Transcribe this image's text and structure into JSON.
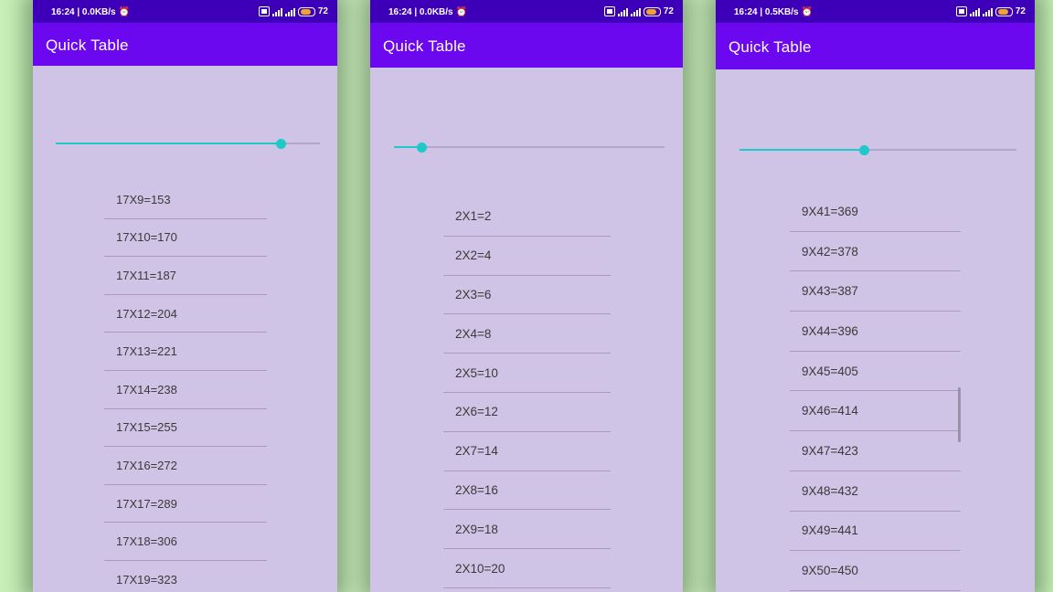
{
  "screens": [
    {
      "status": {
        "time": "16:24 | 0.0KB/s",
        "battery": "72"
      },
      "app_title": "Quick Table",
      "slider_value_fraction": 0.85,
      "rows": [
        "17X9=153",
        "17X10=170",
        "17X11=187",
        "17X12=204",
        "17X13=221",
        "17X14=238",
        "17X15=255",
        "17X16=272",
        "17X17=289",
        "17X18=306",
        "17X19=323"
      ]
    },
    {
      "status": {
        "time": "16:24 | 0.0KB/s",
        "battery": "72"
      },
      "app_title": "Quick Table",
      "slider_value_fraction": 0.1,
      "rows": [
        "2X1=2",
        "2X2=4",
        "2X3=6",
        "2X4=8",
        "2X5=10",
        "2X6=12",
        "2X7=14",
        "2X8=16",
        "2X9=18",
        "2X10=20"
      ]
    },
    {
      "status": {
        "time": "16:24 | 0.5KB/s",
        "battery": "72"
      },
      "app_title": "Quick Table",
      "slider_value_fraction": 0.45,
      "rows": [
        "9X41=369",
        "9X42=378",
        "9X43=387",
        "9X44=396",
        "9X45=405",
        "9X46=414",
        "9X47=423",
        "9X48=432",
        "9X49=441",
        "9X50=450"
      ]
    }
  ],
  "icons": {
    "alarm": "alarm-clock-icon",
    "volte": "volte-icon",
    "signal": "signal-icon",
    "battery": "battery-icon"
  },
  "colors": {
    "status_bar": "#3d00b8",
    "app_bar": "#6b08f0",
    "background": "#cfc4e5",
    "slider_accent": "#1fc9c9",
    "page_background": "#c9f0b8"
  }
}
